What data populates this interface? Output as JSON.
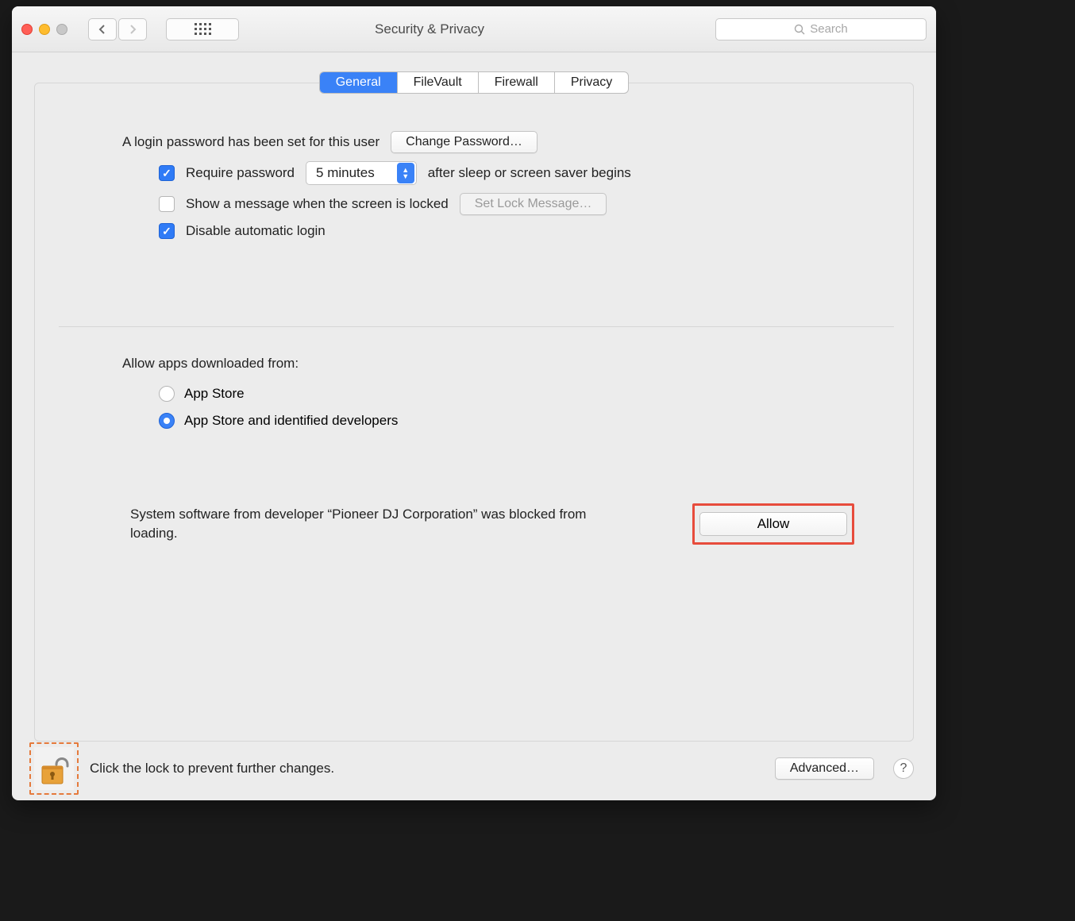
{
  "window": {
    "title": "Security & Privacy"
  },
  "toolbar": {
    "search_placeholder": "Search"
  },
  "tabs": {
    "general": "General",
    "filevault": "FileVault",
    "firewall": "Firewall",
    "privacy": "Privacy"
  },
  "general": {
    "login_password_set": "A login password has been set for this user",
    "change_password_btn": "Change Password…",
    "require_password_label": "Require password",
    "require_password_delay": "5 minutes",
    "after_sleep_label": "after sleep or screen saver begins",
    "show_message_label": "Show a message when the screen is locked",
    "set_lock_message_btn": "Set Lock Message…",
    "disable_auto_login_label": "Disable automatic login",
    "allow_apps_heading": "Allow apps downloaded from:",
    "radio_appstore": "App Store",
    "radio_appstore_dev": "App Store and identified developers",
    "blocked_message": "System software from developer “Pioneer DJ Corporation” was blocked from loading.",
    "allow_btn": "Allow"
  },
  "footer": {
    "lock_text": "Click the lock to prevent further changes.",
    "advanced_btn": "Advanced…",
    "help": "?"
  }
}
